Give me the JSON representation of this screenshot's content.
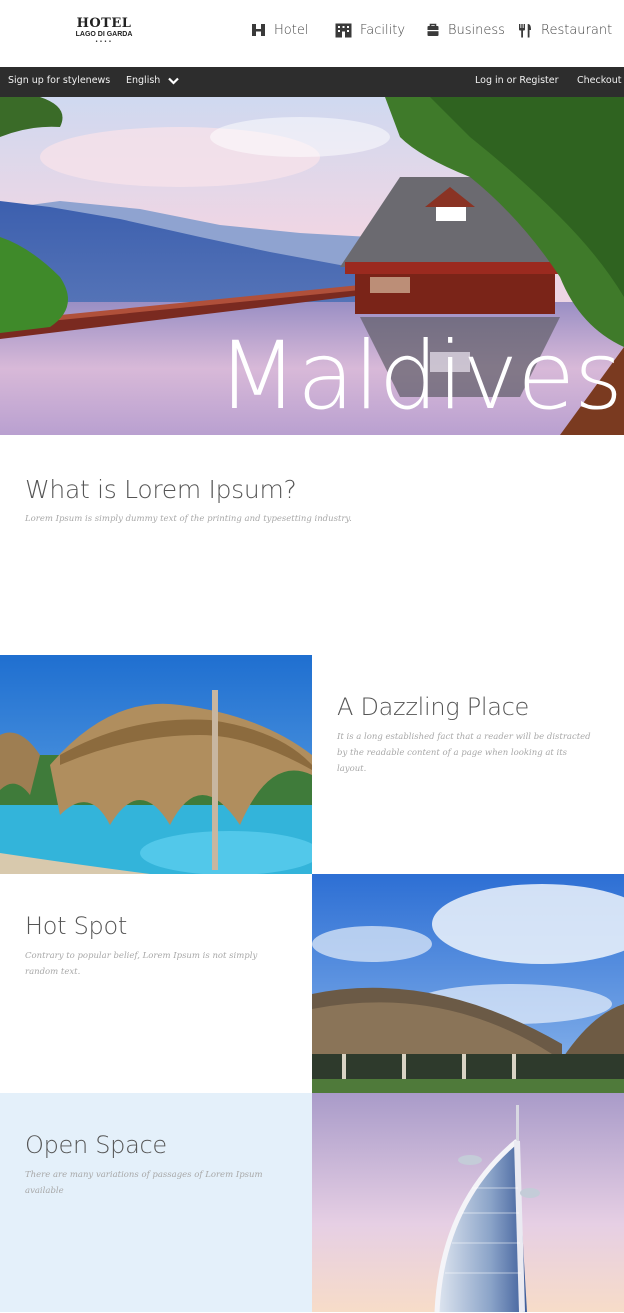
{
  "header": {
    "logo": {
      "title": "HOTEL",
      "subtitle": "LAGO DI GARDA",
      "stars": "••••"
    },
    "nav": [
      {
        "icon": "h-icon",
        "label": "Hotel"
      },
      {
        "icon": "building-icon",
        "label": "Facility"
      },
      {
        "icon": "briefcase-icon",
        "label": "Business"
      },
      {
        "icon": "fork-knife-icon",
        "label": "Restaurant"
      }
    ]
  },
  "topbar": {
    "signup": "Sign up for stylenews",
    "language": "English",
    "login": "Log in or Register",
    "checkout": "Checkout"
  },
  "hero": {
    "title": "Maldives"
  },
  "intro": {
    "heading": "What is Lorem Ipsum?",
    "text": "Lorem Ipsum is simply dummy text of the printing and typesetting industry."
  },
  "features": [
    {
      "heading": "A Dazzling Place",
      "text": "It is a long established fact that a reader will be distracted by the readable content of a page when looking at its layout."
    },
    {
      "heading": "Hot Spot",
      "text": "Contrary to popular belief, Lorem Ipsum is not simply random text."
    },
    {
      "heading": "Open Space",
      "text": "There are many variations of passages of Lorem Ipsum available"
    }
  ],
  "colors": {
    "topbar": "#2d2d2d",
    "open_space_bg": "#e4f0fa",
    "heading": "#555555",
    "body_text": "#a8a8a8"
  }
}
